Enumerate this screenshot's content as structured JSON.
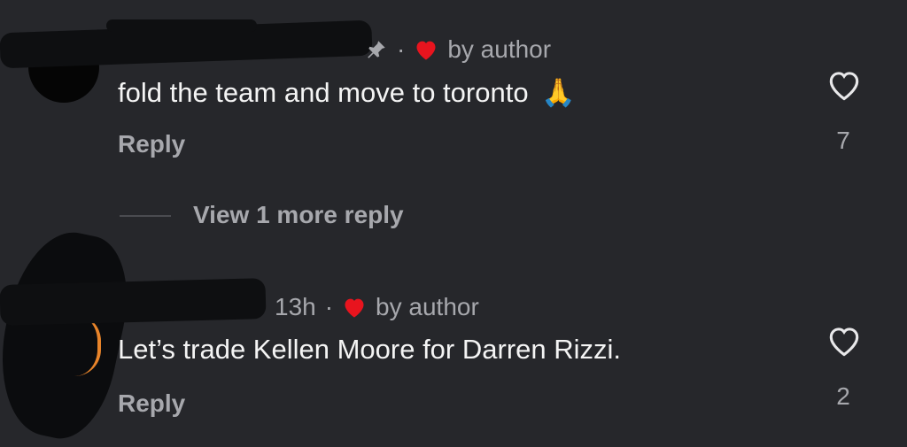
{
  "comments": [
    {
      "username": "",
      "time": "",
      "author_badge": "by author",
      "text": "fold the team and move to toronto",
      "emoji": "🙏",
      "reply_label": "Reply",
      "likes": "7"
    },
    {
      "username": "",
      "time": "13h",
      "author_badge": "by author",
      "text": "Let’s trade Kellen Moore for Darren Rizzi.",
      "reply_label": "Reply",
      "likes": "2"
    }
  ],
  "thread": {
    "view_more_label": "View 1 more reply"
  },
  "colors": {
    "background": "#26272b",
    "author_heart": "#e8141e",
    "secondary_text": "#a7a8ad"
  },
  "icons": [
    "pin-icon",
    "author-heart-icon",
    "like-heart-icon",
    "folded-hands-emoji"
  ]
}
